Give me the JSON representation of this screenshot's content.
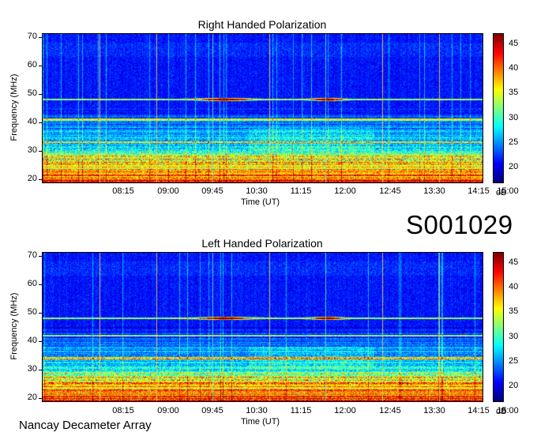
{
  "code": "S001029",
  "footer": "Nancay Decameter Array",
  "chart_data": [
    {
      "type": "heatmap",
      "title": "Right Handed Polarization",
      "xlabel": "Time (UT)",
      "ylabel": "Frequency (MHz)",
      "x_ticks": [
        "08:15",
        "09:00",
        "09:45",
        "10:30",
        "11:15",
        "12:00",
        "12:45",
        "13:30",
        "14:15",
        "15:00"
      ],
      "y_ticks": [
        20,
        30,
        40,
        50,
        60,
        70
      ],
      "ylim": [
        19,
        71
      ],
      "colorbar": {
        "ticks": [
          20,
          25,
          30,
          35,
          40,
          45
        ],
        "range": [
          17,
          47
        ],
        "unit": "dB"
      },
      "features": {
        "strong_band_mhz": [
          20,
          30
        ],
        "emission_lines_mhz": [
          48,
          41,
          33
        ],
        "vertical_markers_time": [
          "08:30",
          "09:15",
          "10:00",
          "10:45",
          "11:30",
          "12:00",
          "12:45",
          "13:30",
          "14:15"
        ]
      }
    },
    {
      "type": "heatmap",
      "title": "Left Handed Polarization",
      "xlabel": "Time (UT)",
      "ylabel": "Frequency (MHz)",
      "x_ticks": [
        "08:15",
        "09:00",
        "09:45",
        "10:30",
        "11:15",
        "12:00",
        "12:45",
        "13:30",
        "14:15",
        "15:00"
      ],
      "y_ticks": [
        20,
        30,
        40,
        50,
        60,
        70
      ],
      "ylim": [
        19,
        71
      ],
      "colorbar": {
        "ticks": [
          20,
          25,
          30,
          35,
          40,
          45
        ],
        "range": [
          17,
          47
        ],
        "unit": "dB"
      },
      "features": {
        "strong_band_mhz": [
          20,
          30
        ],
        "emission_lines_mhz": [
          48,
          42,
          34
        ],
        "vertical_markers_time": [
          "08:30",
          "09:15",
          "10:00",
          "10:45",
          "11:30",
          "12:00",
          "12:45",
          "13:30",
          "14:15"
        ]
      }
    }
  ]
}
